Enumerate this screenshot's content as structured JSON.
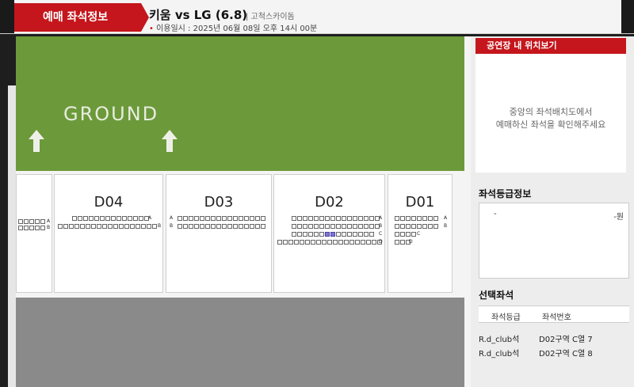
{
  "header": {
    "tab_title": "예매 좌석정보",
    "game_title": "키움 vs LG (6.8)",
    "venue": "| 고척스카이돔",
    "datetime": "이용일시 : 2025년 06월 08일 오후 14시 00분"
  },
  "map": {
    "ground_label": "GROUND",
    "blocks": [
      {
        "label": "",
        "rows": [
          "A",
          "B"
        ]
      },
      {
        "label": "D04",
        "rows": [
          "A",
          "B"
        ]
      },
      {
        "label": "D03",
        "rows": [
          "A",
          "B"
        ]
      },
      {
        "label": "D02",
        "rows": [
          "A",
          "B",
          "C",
          "D"
        ]
      },
      {
        "label": "D01",
        "rows": [
          "A",
          "B",
          "C",
          "D"
        ]
      }
    ]
  },
  "right_panel": {
    "location_header": "공연장 내 위치보기",
    "location_line1": "중앙의 좌석배치도에서",
    "location_line2": "예매하신 좌석을 확인해주세요",
    "grade_title": "좌석등급정보",
    "grade_name": "-",
    "grade_price": "-원",
    "selected_title": "선택좌석",
    "col_grade": "좌석등급",
    "col_seat": "좌석번호",
    "selected": [
      {
        "grade": "R.d_club석",
        "seat": "D02구역 C열 7"
      },
      {
        "grade": "R.d_club석",
        "seat": "D02구역 C열 8"
      }
    ]
  },
  "colors": {
    "brand_red": "#c4161c",
    "ground_green": "#6c9a3a",
    "selected_seat": "#7d74d6"
  }
}
